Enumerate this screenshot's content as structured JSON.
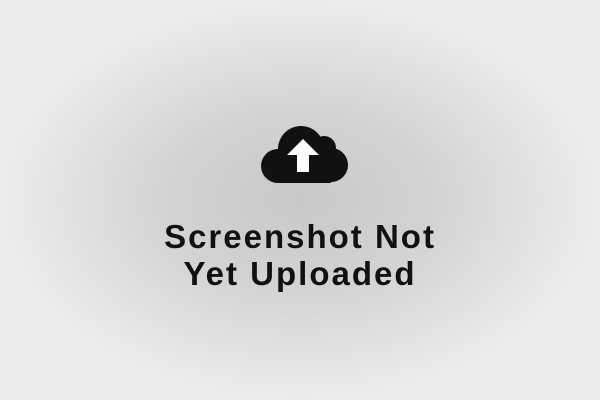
{
  "placeholder": {
    "icon": "cloud-upload-icon",
    "message_line_1": "Screenshot Not",
    "message_line_2": "Yet Uploaded",
    "text_color": "#111111",
    "background_center": "#c8c8c8",
    "background_edge": "#ececec"
  }
}
